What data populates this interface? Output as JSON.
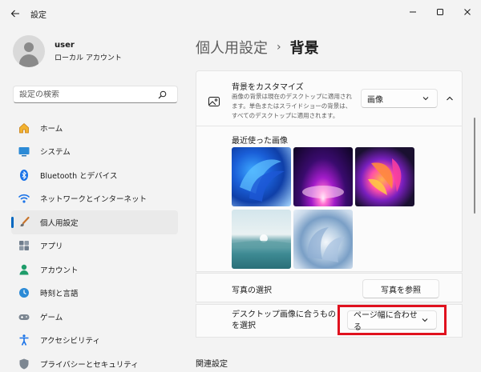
{
  "window": {
    "title": "設定",
    "back_icon": "arrow-left-icon",
    "controls": [
      "minimize-icon",
      "maximize-icon",
      "close-icon"
    ]
  },
  "profile": {
    "name": "user",
    "account_type": "ローカル アカウント"
  },
  "search": {
    "placeholder": "設定の検索",
    "value": ""
  },
  "sidebar": {
    "items": [
      {
        "label": "ホーム",
        "icon": "home-icon",
        "active": false
      },
      {
        "label": "システム",
        "icon": "system-icon",
        "active": false
      },
      {
        "label": "Bluetooth とデバイス",
        "icon": "bluetooth-icon",
        "active": false
      },
      {
        "label": "ネットワークとインターネット",
        "icon": "wifi-icon",
        "active": false
      },
      {
        "label": "個人用設定",
        "icon": "brush-icon",
        "active": true
      },
      {
        "label": "アプリ",
        "icon": "apps-icon",
        "active": false
      },
      {
        "label": "アカウント",
        "icon": "account-icon",
        "active": false
      },
      {
        "label": "時刻と言語",
        "icon": "time-language-icon",
        "active": false
      },
      {
        "label": "ゲーム",
        "icon": "gamepad-icon",
        "active": false
      },
      {
        "label": "アクセシビリティ",
        "icon": "accessibility-icon",
        "active": false
      },
      {
        "label": "プライバシーとセキュリティ",
        "icon": "shield-icon",
        "active": false
      }
    ]
  },
  "breadcrumb": {
    "parent": "個人用設定",
    "separator": "›",
    "current": "背景"
  },
  "background": {
    "title": "背景をカスタマイズ",
    "description": "画像の背景は現在のデスクトップに適用されます。単色またはスライドショーの背景は、すべてのデスクトップに適用されます。",
    "type_value": "画像",
    "recent_label": "最近使った画像",
    "thumbnails": [
      "bloom-blue",
      "glow-purple",
      "ribbon-colorful",
      "lake-sunrise",
      "bloom-silver"
    ],
    "photo_label": "写真の選択",
    "browse_label": "写真を参照",
    "fit_label": "デスクトップ画像に合うものを選択",
    "fit_value": "ページ幅に合わせる"
  },
  "related": {
    "heading": "関連設定"
  },
  "colors": {
    "accent": "#0067c0",
    "highlight": "#e0111e"
  }
}
